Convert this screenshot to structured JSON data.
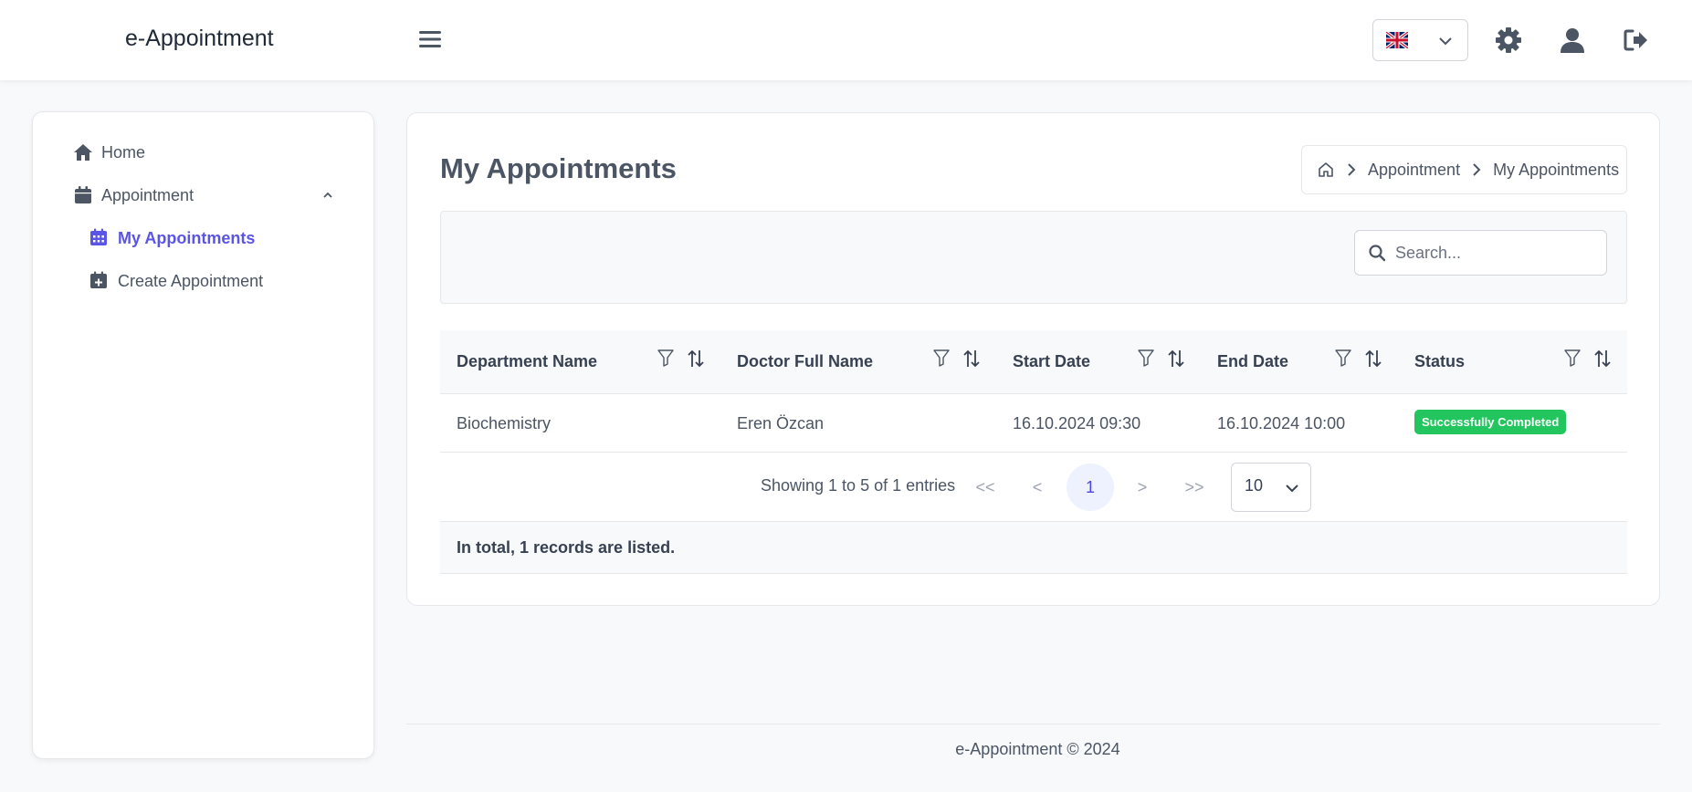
{
  "header": {
    "brand": "e-Appointment",
    "menu_icon": "hamburger-icon",
    "language_icon": "uk-flag-icon",
    "icons": [
      "gear-icon",
      "user-icon",
      "logout-icon"
    ]
  },
  "sidebar": {
    "items": [
      {
        "label": "Home",
        "icon": "home-icon"
      },
      {
        "label": "Appointment",
        "icon": "calendar-icon"
      },
      {
        "label": "My Appointments",
        "icon": "calendar-grid-icon",
        "active": true
      },
      {
        "label": "Create Appointment",
        "icon": "calendar-plus-icon"
      }
    ]
  },
  "main": {
    "title": "My Appointments",
    "breadcrumb": [
      "Appointment",
      "My Appointments"
    ],
    "search_placeholder": "Search...",
    "table": {
      "columns": [
        "Department Name",
        "Doctor Full Name",
        "Start Date",
        "End Date",
        "Status"
      ],
      "rows": [
        {
          "department": "Biochemistry",
          "doctor": "Eren Özcan",
          "start": "16.10.2024 09:30",
          "end": "16.10.2024 10:00",
          "status": "Successfully Completed"
        }
      ]
    },
    "pagination": {
      "info": "Showing 1 to 5 of 1 entries",
      "first": "<<",
      "prev": "<",
      "current": "1",
      "next": ">",
      "last": ">>",
      "per_page": "10"
    },
    "total_text": "In total, 1 records are listed."
  },
  "footer": {
    "text": "e-Appointment © 2024"
  },
  "colors": {
    "accent": "#5b55e6",
    "success": "#22c55e",
    "text": "#4b5563"
  }
}
